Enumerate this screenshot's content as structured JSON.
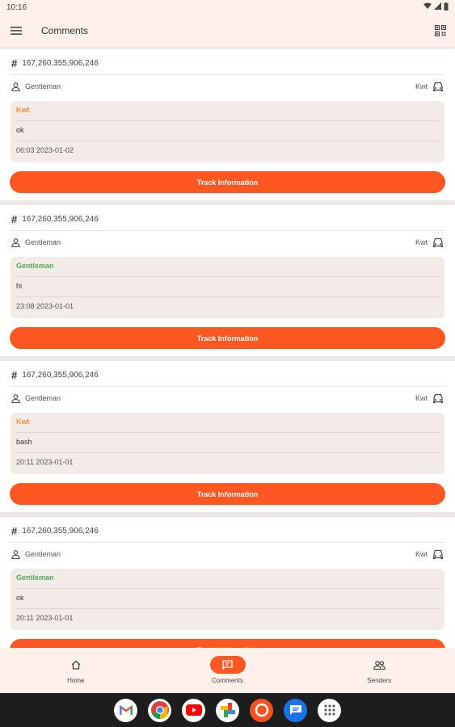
{
  "status": {
    "time": "10:16"
  },
  "appbar": {
    "title": "Comments"
  },
  "cards": [
    {
      "id": "167,260,355,906,246",
      "user": "Gentleman",
      "vehicle": "Kwt",
      "comment_author": "Kwt",
      "author_color": "#f58d3b",
      "comment_text": "ok",
      "comment_time": "06:03 2023-01-02",
      "button": "Track Information"
    },
    {
      "id": "167,260,355,906,246",
      "user": "Gentleman",
      "vehicle": "Kwt",
      "comment_author": "Gentleman",
      "author_color": "#4caf50",
      "comment_text": "hi",
      "comment_time": "23:08 2023-01-01",
      "button": "Track Information"
    },
    {
      "id": "167,260,355,906,246",
      "user": "Gentleman",
      "vehicle": "Kwt",
      "comment_author": "Kwt",
      "author_color": "#f58d3b",
      "comment_text": "bash",
      "comment_time": "20:11 2023-01-01",
      "button": "Track Information"
    },
    {
      "id": "167,260,355,906,246",
      "user": "Gentleman",
      "vehicle": "Kwt",
      "comment_author": "Gentleman",
      "author_color": "#4caf50",
      "comment_text": "ok",
      "comment_time": "20:11 2023-01-01",
      "button": "Track Information"
    }
  ],
  "nav": {
    "home": "Home",
    "comments": "Comments",
    "senders": "Senders"
  },
  "colors": {
    "accent": "#ff5722",
    "appbar_bg": "#fff0ea",
    "card_bg": "#ffffff",
    "comment_bg": "#f3ebe7"
  },
  "dock": [
    "gmail-icon",
    "chrome-icon",
    "youtube-icon",
    "photos-icon",
    "app-ring-icon",
    "messages-icon",
    "apps-grid-icon"
  ]
}
